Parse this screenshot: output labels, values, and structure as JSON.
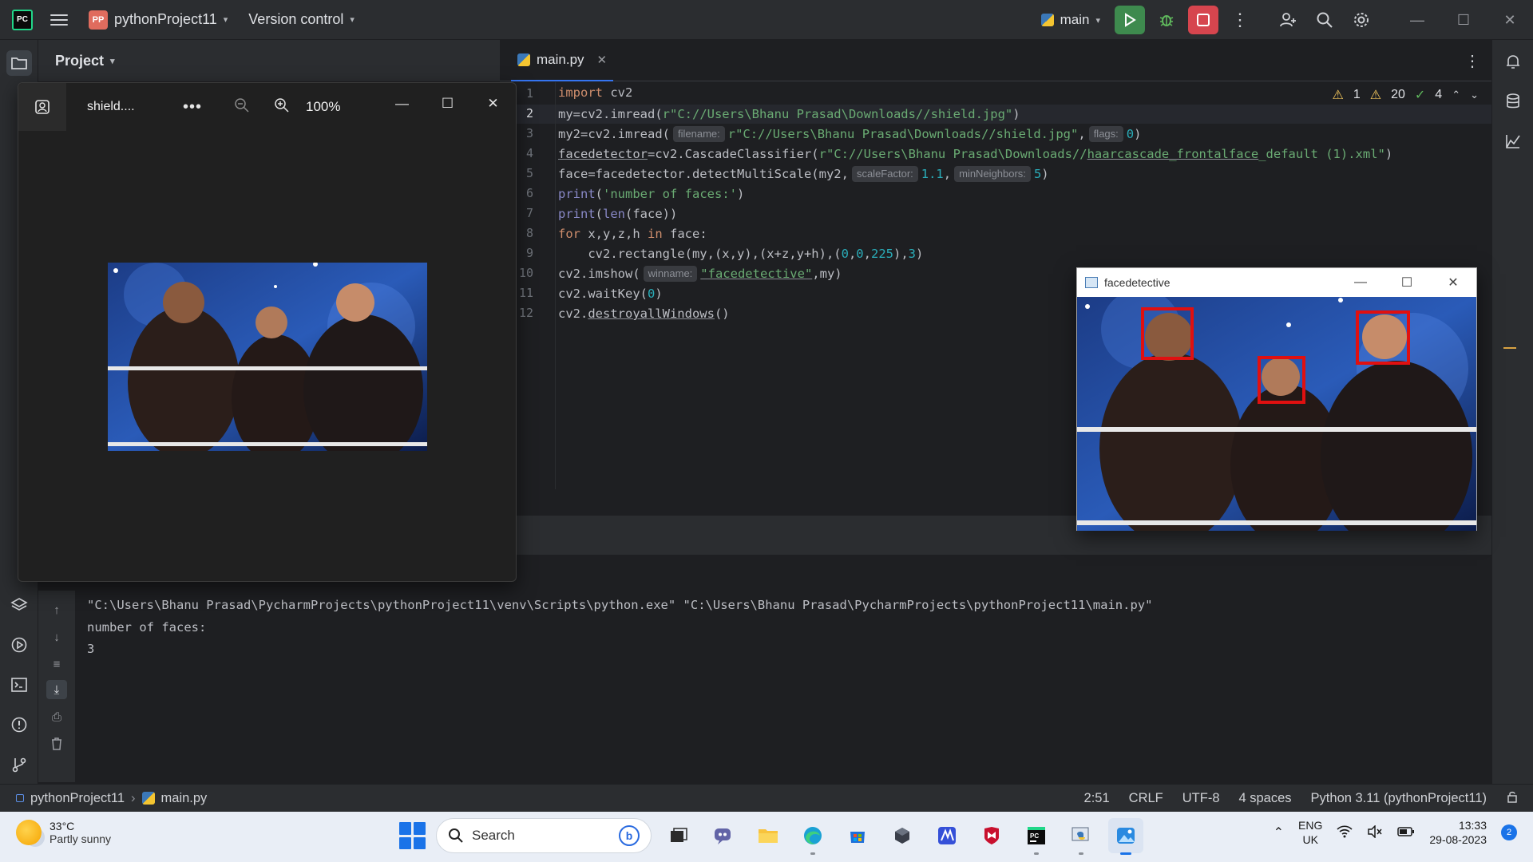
{
  "titlebar": {
    "project_badge": "PP",
    "project_name": "pythonProject11",
    "version_control": "Version control",
    "branch": "main"
  },
  "project_panel": {
    "title": "Project"
  },
  "editor": {
    "tab_label": "main.py",
    "inspections": {
      "warnings_yellow": "1",
      "warnings": "20",
      "ok": "4"
    },
    "line_numbers": [
      "1",
      "2",
      "3",
      "4",
      "5",
      "6",
      "7",
      "8",
      "9",
      "10",
      "11",
      "12"
    ],
    "lines": {
      "l1_kw": "import",
      "l1_rest": " cv2",
      "l2_a": "my=cv2.imread(",
      "l2_str": "r\"C://Users\\Bhanu Prasad\\Downloads//shield.jpg\"",
      "l2_b": ")",
      "l3_a": "my2=cv2.imread(",
      "l3_hint1": "filename:",
      "l3_str": "r\"C://Users\\Bhanu Prasad\\Downloads//shield.jpg\"",
      "l3_sep": ",",
      "l3_hint2": "flags:",
      "l3_num": "0",
      "l3_b": ")",
      "l4_a": "facedetector",
      "l4_b": "=cv2.CascadeClassifier(",
      "l4_str1": "r\"C://Users\\Bhanu Prasad\\Downloads//",
      "l4_str2": "haarcascade_frontalface",
      "l4_str3": "_default (1).xml\"",
      "l4_c": ")",
      "l5_a": "face=facedetector.detectMultiScale(my2,",
      "l5_hint1": "scaleFactor:",
      "l5_num1": "1.1",
      "l5_sep": ",",
      "l5_hint2": "minNeighbors:",
      "l5_num2": "5",
      "l5_b": ")",
      "l6_fn": "print",
      "l6_a": "(",
      "l6_str": "'number of faces:'",
      "l6_b": ")",
      "l7_fn": "print",
      "l7_a": "(",
      "l7_bi": "len",
      "l7_b": "(face))",
      "l8_kw1": "for",
      "l8_a": " x,y,z,h ",
      "l8_kw2": "in",
      "l8_b": " face:",
      "l9_a": "    cv2.rectangle(my,(x,y),(x+z,y+h),(",
      "l9_n1": "0",
      "l9_c1": ",",
      "l9_n2": "0",
      "l9_c2": ",",
      "l9_n3": "225",
      "l9_b": "),",
      "l9_n4": "3",
      "l9_c": ")",
      "l10_a": "cv2.imshow(",
      "l10_hint": "winname:",
      "l10_str": "\"facedetective\"",
      "l10_b": ",my)",
      "l11_a": "cv2.waitKey(",
      "l11_num": "0",
      "l11_b": ")",
      "l12_a": "cv2.",
      "l12_u": "destroyallWindows",
      "l12_b": "()"
    }
  },
  "console": {
    "lines": [
      "\"C:\\Users\\Bhanu Prasad\\PycharmProjects\\pythonProject11\\venv\\Scripts\\python.exe\" \"C:\\Users\\Bhanu Prasad\\PycharmProjects\\pythonProject11\\main.py\"",
      "number of faces:",
      "3"
    ]
  },
  "statusbar": {
    "project": "pythonProject11",
    "file": "main.py",
    "position": "2:51",
    "line_sep": "CRLF",
    "encoding": "UTF-8",
    "indent": "4 spaces",
    "interpreter": "Python 3.11 (pythonProject11)"
  },
  "photos_viewer": {
    "title": "shield....",
    "more": "•••",
    "zoom": "100%"
  },
  "face_window": {
    "title": "facedetective"
  },
  "taskbar": {
    "temperature": "33°C",
    "weather": "Partly sunny",
    "search_placeholder": "Search",
    "lang_1": "ENG",
    "lang_2": "UK",
    "time": "13:33",
    "date": "29-08-2023",
    "notifications": "2"
  },
  "colors": {
    "ide_bg": "#1e1f22",
    "panel_bg": "#2b2d30",
    "accent": "#3574f0",
    "run_green": "#3e8a4e",
    "stop_red": "#d6454e",
    "face_box": "#e01010"
  }
}
